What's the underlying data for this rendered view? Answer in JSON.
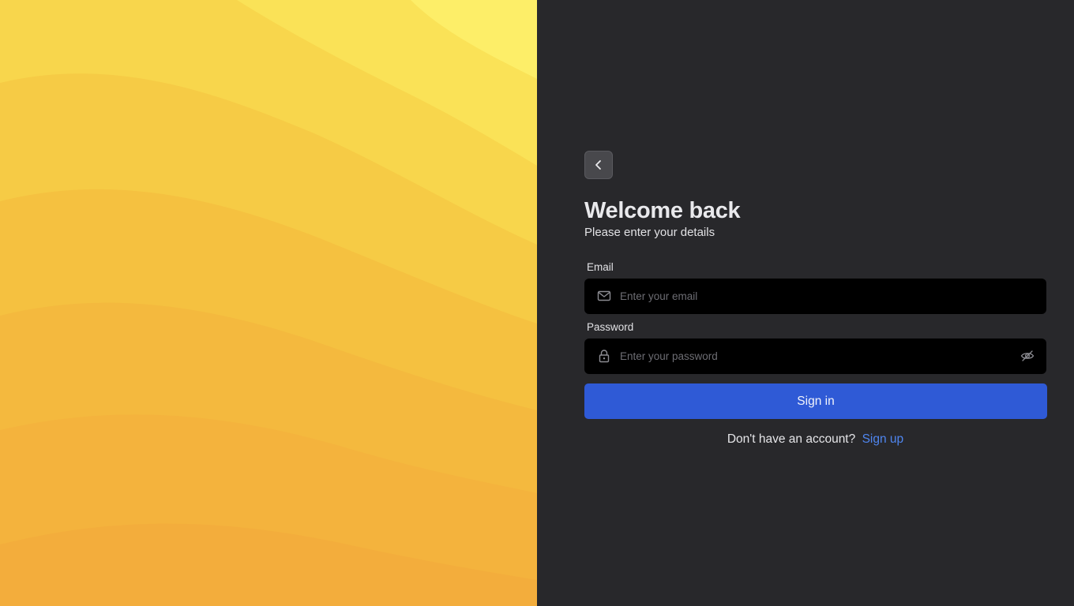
{
  "colors": {
    "auth_background": "#28282b",
    "input_background": "#000000",
    "primary_button": "#2f5ad6",
    "link": "#4f86f0",
    "art_band_colors": [
      "#fdee68",
      "#fae257",
      "#f8d64c",
      "#f6cb45",
      "#f5c140",
      "#f4b93e",
      "#f4b23e"
    ]
  },
  "back_button": {
    "icon": "chevron-left-icon"
  },
  "header": {
    "title": "Welcome back",
    "subtitle": "Please enter your details"
  },
  "form": {
    "email": {
      "label": "Email",
      "placeholder": "Enter your email",
      "value": "",
      "icon": "mail-icon"
    },
    "password": {
      "label": "Password",
      "placeholder": "Enter your password",
      "value": "",
      "icon": "lock-icon",
      "toggle_icon": "eye-off-icon"
    },
    "submit_label": "Sign in"
  },
  "footer": {
    "prompt": "Don't have an account?",
    "link_label": "Sign up"
  }
}
